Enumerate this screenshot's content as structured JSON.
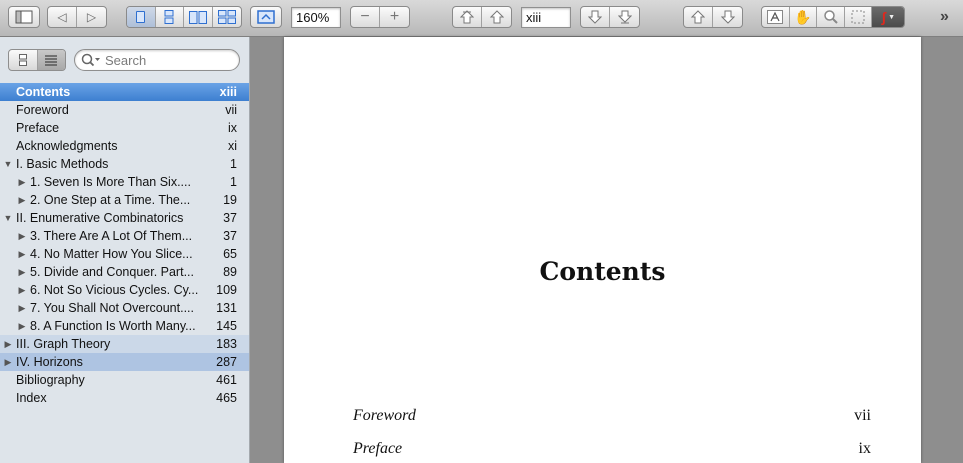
{
  "toolbar": {
    "zoom_value": "160%",
    "page_value": "xiii",
    "overflow_label": "»"
  },
  "sidebar": {
    "search_placeholder": "Search",
    "items": [
      {
        "label": "Contents",
        "page": "xiii",
        "level": 0,
        "toggle": "",
        "state": "selected"
      },
      {
        "label": "Foreword",
        "page": "vii",
        "level": 0,
        "toggle": "",
        "state": ""
      },
      {
        "label": "Preface",
        "page": "ix",
        "level": 0,
        "toggle": "",
        "state": ""
      },
      {
        "label": "Acknowledgments",
        "page": "xi",
        "level": 0,
        "toggle": "",
        "state": ""
      },
      {
        "label": "I. Basic Methods",
        "page": "1",
        "level": 0,
        "toggle": "expanded",
        "state": ""
      },
      {
        "label": "1. Seven Is More Than Six....",
        "page": "1",
        "level": 1,
        "toggle": "collapsed",
        "state": ""
      },
      {
        "label": "2. One Step at a Time. The...",
        "page": "19",
        "level": 1,
        "toggle": "collapsed",
        "state": ""
      },
      {
        "label": "II. Enumerative Combinatorics",
        "page": "37",
        "level": 0,
        "toggle": "expanded",
        "state": ""
      },
      {
        "label": "3. There Are A Lot Of Them...",
        "page": "37",
        "level": 1,
        "toggle": "collapsed",
        "state": ""
      },
      {
        "label": "4. No Matter How You Slice...",
        "page": "65",
        "level": 1,
        "toggle": "collapsed",
        "state": ""
      },
      {
        "label": "5. Divide and Conquer. Part...",
        "page": "89",
        "level": 1,
        "toggle": "collapsed",
        "state": ""
      },
      {
        "label": "6. Not So Vicious Cycles. Cy...",
        "page": "109",
        "level": 1,
        "toggle": "collapsed",
        "state": ""
      },
      {
        "label": "7. You Shall Not Overcount....",
        "page": "131",
        "level": 1,
        "toggle": "collapsed",
        "state": ""
      },
      {
        "label": "8. A Function Is Worth Many...",
        "page": "145",
        "level": 1,
        "toggle": "collapsed",
        "state": ""
      },
      {
        "label": "III. Graph Theory",
        "page": "183",
        "level": 0,
        "toggle": "collapsed",
        "state": "hilite-light"
      },
      {
        "label": "IV. Horizons",
        "page": "287",
        "level": 0,
        "toggle": "collapsed",
        "state": "hilite"
      },
      {
        "label": "Bibliography",
        "page": "461",
        "level": 0,
        "toggle": "",
        "state": ""
      },
      {
        "label": "Index",
        "page": "465",
        "level": 0,
        "toggle": "",
        "state": ""
      }
    ]
  },
  "document": {
    "title": "Contents",
    "entries": [
      {
        "title": "Foreword",
        "page": "vii"
      },
      {
        "title": "Preface",
        "page": "ix"
      }
    ]
  }
}
